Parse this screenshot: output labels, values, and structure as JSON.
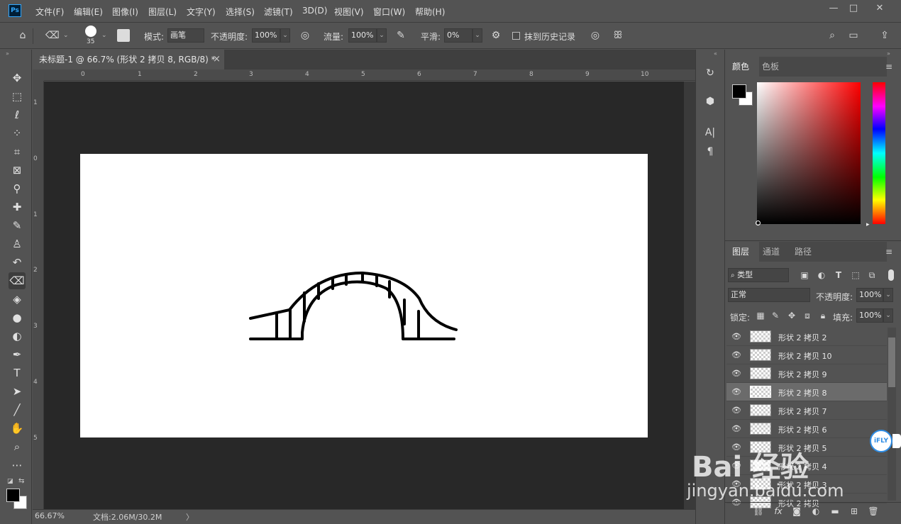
{
  "app": {
    "logo": "Ps"
  },
  "menu": [
    "文件(F)",
    "编辑(E)",
    "图像(I)",
    "图层(L)",
    "文字(Y)",
    "选择(S)",
    "滤镜(T)",
    "3D(D)",
    "视图(V)",
    "窗口(W)",
    "帮助(H)"
  ],
  "window_controls": {
    "minimize": "—",
    "restore": "□",
    "close": "✕"
  },
  "options": {
    "brush_size": "35",
    "mode_label": "模式:",
    "mode_value": "画笔",
    "opacity_label": "不透明度:",
    "opacity_value": "100%",
    "flow_label": "流量:",
    "flow_value": "100%",
    "smooth_label": "平滑:",
    "smooth_value": "0%",
    "erase_history_label": "抹到历史记录"
  },
  "document": {
    "tab_title": "未标题-1 @ 66.7% (形状 2 拷贝 8, RGB/8) *",
    "close_glyph": "×"
  },
  "ruler": {
    "top_ticks": [
      "0",
      "1",
      "2",
      "3",
      "4",
      "5",
      "6",
      "7",
      "8",
      "9",
      "10"
    ],
    "left_ticks": [
      "1",
      "0",
      "1",
      "2",
      "3",
      "4",
      "5"
    ]
  },
  "status": {
    "zoom": "66.67%",
    "doc_size": "文档:2.06M/30.2M",
    "arrow": "〉"
  },
  "color_panel": {
    "tabs": [
      "颜色",
      "色板"
    ],
    "foreground": "#000000",
    "background": "#ffffff",
    "hue_color": "#ff0000"
  },
  "layers_panel": {
    "tabs": [
      "图层",
      "通道",
      "路径"
    ],
    "filter_kind": "类型",
    "blend_mode": "正常",
    "opacity_label": "不透明度:",
    "opacity_value": "100%",
    "lock_label": "锁定:",
    "fill_label": "填充:",
    "fill_value": "100%",
    "layers": [
      {
        "name": "形状 2 拷贝 2",
        "selected": false
      },
      {
        "name": "形状 2 拷贝 10",
        "selected": false
      },
      {
        "name": "形状 2 拷贝 9",
        "selected": false
      },
      {
        "name": "形状 2 拷贝 8",
        "selected": true
      },
      {
        "name": "形状 2 拷贝 7",
        "selected": false
      },
      {
        "name": "形状 2 拷贝 6",
        "selected": false
      },
      {
        "name": "形状 2 拷贝 5",
        "selected": false
      },
      {
        "name": "形状 2 拷贝 4",
        "selected": false
      },
      {
        "name": "形状 2 拷贝 3",
        "selected": false
      },
      {
        "name": "形状 2 拷贝",
        "selected": false
      }
    ],
    "footer_fx": "fx"
  },
  "overlay": {
    "baidu_logo": "Bai 经验",
    "baidu_url": "jingyan.baidu.com",
    "ifly_badge": "iFLY"
  }
}
